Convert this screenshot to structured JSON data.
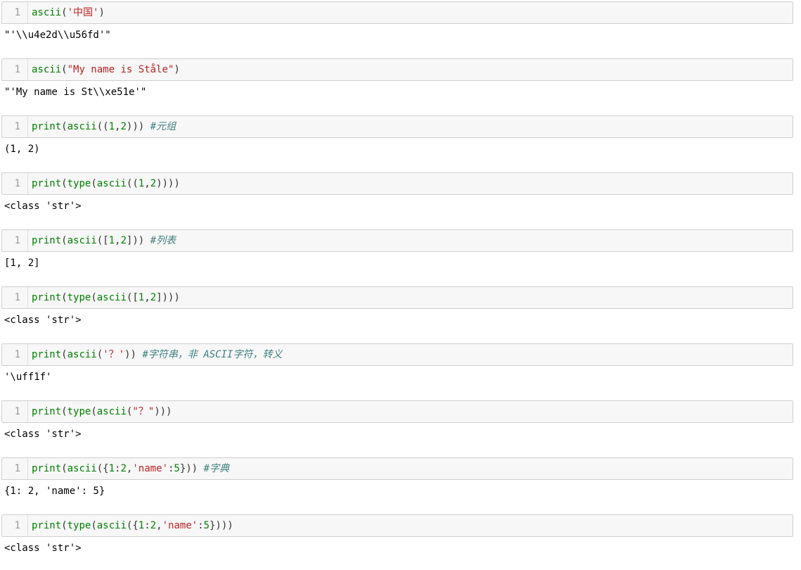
{
  "cells": [
    {
      "line_number": "1",
      "code": [
        {
          "t": "ascii",
          "c": "kw"
        },
        {
          "t": "(",
          "c": "plain"
        },
        {
          "t": "'中国'",
          "c": "str"
        },
        {
          "t": ")",
          "c": "plain"
        }
      ],
      "output": "\"'\\\\u4e2d\\\\u56fd'\""
    },
    {
      "line_number": "1",
      "code": [
        {
          "t": "ascii",
          "c": "kw"
        },
        {
          "t": "(",
          "c": "plain"
        },
        {
          "t": "\"My name is Ståle\"",
          "c": "str"
        },
        {
          "t": ")",
          "c": "plain"
        }
      ],
      "output": "\"'My name is St\\\\xe51e'\""
    },
    {
      "line_number": "1",
      "code": [
        {
          "t": "print",
          "c": "kw"
        },
        {
          "t": "(",
          "c": "plain"
        },
        {
          "t": "ascii",
          "c": "kw"
        },
        {
          "t": "((",
          "c": "plain"
        },
        {
          "t": "1",
          "c": "num"
        },
        {
          "t": ",",
          "c": "plain"
        },
        {
          "t": "2",
          "c": "num"
        },
        {
          "t": "))) ",
          "c": "plain"
        },
        {
          "t": "#元组",
          "c": "com"
        }
      ],
      "output": "(1, 2)"
    },
    {
      "line_number": "1",
      "code": [
        {
          "t": "print",
          "c": "kw"
        },
        {
          "t": "(",
          "c": "plain"
        },
        {
          "t": "type",
          "c": "kw"
        },
        {
          "t": "(",
          "c": "plain"
        },
        {
          "t": "ascii",
          "c": "kw"
        },
        {
          "t": "((",
          "c": "plain"
        },
        {
          "t": "1",
          "c": "num"
        },
        {
          "t": ",",
          "c": "plain"
        },
        {
          "t": "2",
          "c": "num"
        },
        {
          "t": "))))",
          "c": "plain"
        }
      ],
      "output": "<class 'str'>"
    },
    {
      "line_number": "1",
      "code": [
        {
          "t": "print",
          "c": "kw"
        },
        {
          "t": "(",
          "c": "plain"
        },
        {
          "t": "ascii",
          "c": "kw"
        },
        {
          "t": "([",
          "c": "plain"
        },
        {
          "t": "1",
          "c": "num"
        },
        {
          "t": ",",
          "c": "plain"
        },
        {
          "t": "2",
          "c": "num"
        },
        {
          "t": "])) ",
          "c": "plain"
        },
        {
          "t": "#列表",
          "c": "com"
        }
      ],
      "output": "[1, 2]"
    },
    {
      "line_number": "1",
      "code": [
        {
          "t": "print",
          "c": "kw"
        },
        {
          "t": "(",
          "c": "plain"
        },
        {
          "t": "type",
          "c": "kw"
        },
        {
          "t": "(",
          "c": "plain"
        },
        {
          "t": "ascii",
          "c": "kw"
        },
        {
          "t": "([",
          "c": "plain"
        },
        {
          "t": "1",
          "c": "num"
        },
        {
          "t": ",",
          "c": "plain"
        },
        {
          "t": "2",
          "c": "num"
        },
        {
          "t": "])))",
          "c": "plain"
        }
      ],
      "output": "<class 'str'>"
    },
    {
      "line_number": "1",
      "code": [
        {
          "t": "print",
          "c": "kw"
        },
        {
          "t": "(",
          "c": "plain"
        },
        {
          "t": "ascii",
          "c": "kw"
        },
        {
          "t": "(",
          "c": "plain"
        },
        {
          "t": "'？'",
          "c": "str"
        },
        {
          "t": ")) ",
          "c": "plain"
        },
        {
          "t": "#字符串，非 ASCII字符，转义",
          "c": "com"
        }
      ],
      "output": "'\\uff1f'"
    },
    {
      "line_number": "1",
      "code": [
        {
          "t": "print",
          "c": "kw"
        },
        {
          "t": "(",
          "c": "plain"
        },
        {
          "t": "type",
          "c": "kw"
        },
        {
          "t": "(",
          "c": "plain"
        },
        {
          "t": "ascii",
          "c": "kw"
        },
        {
          "t": "(",
          "c": "plain"
        },
        {
          "t": "\"？\"",
          "c": "str"
        },
        {
          "t": ")))",
          "c": "plain"
        }
      ],
      "output": "<class 'str'>"
    },
    {
      "line_number": "1",
      "code": [
        {
          "t": "print",
          "c": "kw"
        },
        {
          "t": "(",
          "c": "plain"
        },
        {
          "t": "ascii",
          "c": "kw"
        },
        {
          "t": "({",
          "c": "plain"
        },
        {
          "t": "1",
          "c": "num"
        },
        {
          "t": ":",
          "c": "plain"
        },
        {
          "t": "2",
          "c": "num"
        },
        {
          "t": ",",
          "c": "plain"
        },
        {
          "t": "'name'",
          "c": "str"
        },
        {
          "t": ":",
          "c": "plain"
        },
        {
          "t": "5",
          "c": "num"
        },
        {
          "t": "})) ",
          "c": "plain"
        },
        {
          "t": "#字典",
          "c": "com"
        }
      ],
      "output": "{1: 2, 'name': 5}"
    },
    {
      "line_number": "1",
      "code": [
        {
          "t": "print",
          "c": "kw"
        },
        {
          "t": "(",
          "c": "plain"
        },
        {
          "t": "type",
          "c": "kw"
        },
        {
          "t": "(",
          "c": "plain"
        },
        {
          "t": "ascii",
          "c": "kw"
        },
        {
          "t": "({",
          "c": "plain"
        },
        {
          "t": "1",
          "c": "num"
        },
        {
          "t": ":",
          "c": "plain"
        },
        {
          "t": "2",
          "c": "num"
        },
        {
          "t": ",",
          "c": "plain"
        },
        {
          "t": "'name'",
          "c": "str"
        },
        {
          "t": ":",
          "c": "plain"
        },
        {
          "t": "5",
          "c": "num"
        },
        {
          "t": "})))",
          "c": "plain"
        }
      ],
      "output": "<class 'str'>"
    }
  ]
}
